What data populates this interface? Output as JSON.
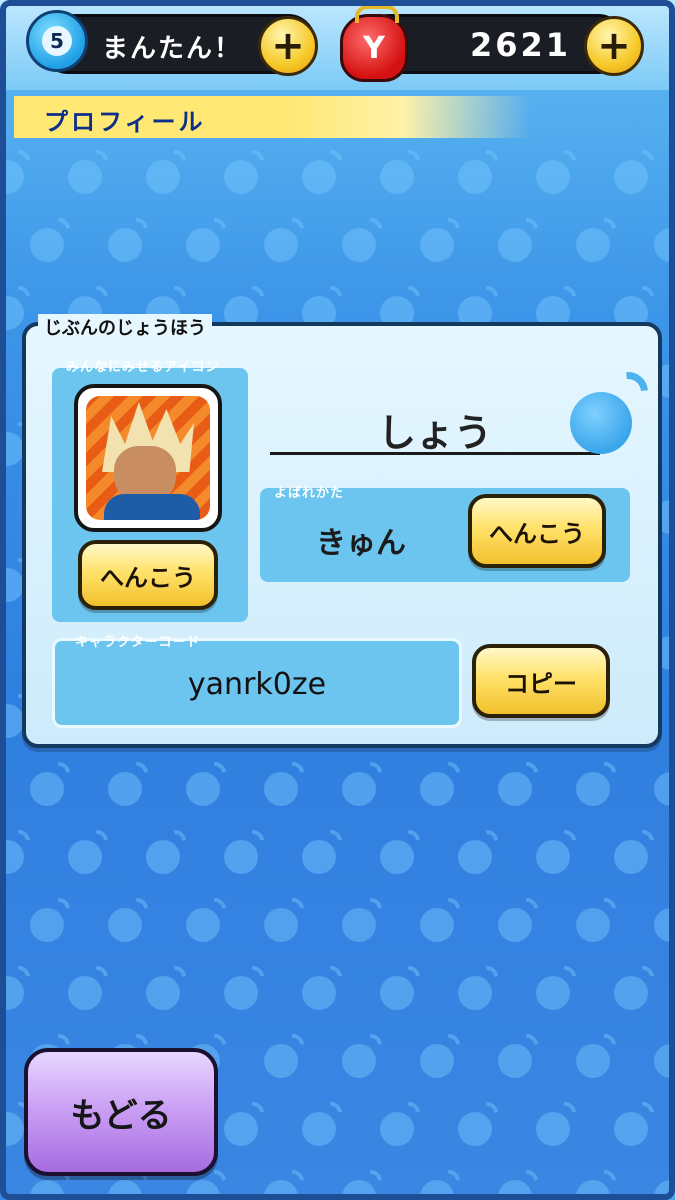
{
  "header": {
    "level": "5",
    "level_label": "まんたん！",
    "currency_symbol": "Y",
    "currency_amount": "2621",
    "plus_symbol": "+"
  },
  "screen_title": "プロフィール",
  "profile": {
    "section_label": "じぶんのじょうほう",
    "icon_label": "みんなにみせるアイコン",
    "change_icon_button": "へんこう",
    "player_name": "しょう",
    "nickname_label": "よばれかた",
    "nickname_value": "きゅん",
    "change_nickname_button": "へんこう",
    "code_label": "キャラクターコード",
    "code_value": "yanrk0ze",
    "copy_button": "コピー"
  },
  "footer": {
    "back_button": "もどる"
  },
  "icons": [
    "level-badge-icon",
    "plus-icon",
    "yen-purse-icon",
    "water-drop-icon",
    "avatar-portrait"
  ]
}
